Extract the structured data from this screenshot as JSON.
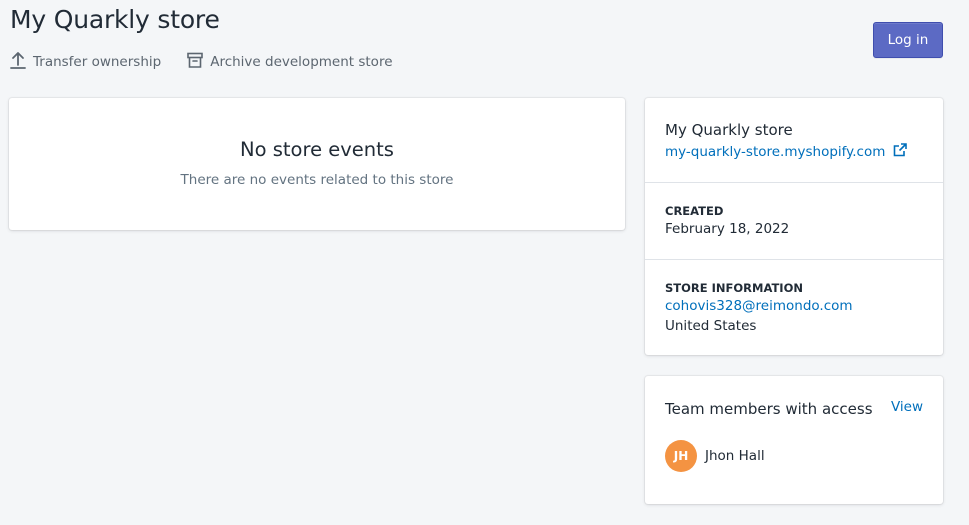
{
  "header": {
    "title": "My Quarkly store",
    "actions": [
      {
        "label": "Transfer ownership",
        "icon": "upload-icon"
      },
      {
        "label": "Archive development store",
        "icon": "archive-icon"
      }
    ],
    "login_label": "Log in"
  },
  "events": {
    "title": "No store events",
    "subtitle": "There are no events related to this store"
  },
  "store": {
    "name": "My Quarkly store",
    "url": "my-quarkly-store.myshopify.com",
    "created_label": "CREATED",
    "created_value": "February 18, 2022",
    "info_label": "STORE INFORMATION",
    "email": "cohovis328@reimondo.com",
    "country": "United States"
  },
  "team": {
    "title": "Team members with access",
    "view_label": "View",
    "members": [
      {
        "initials": "JH",
        "name": "Jhon Hall"
      }
    ]
  },
  "colors": {
    "accent": "#5c6ac4",
    "link": "#006fbb",
    "avatar": "#f49342",
    "background": "#f4f6f8"
  }
}
